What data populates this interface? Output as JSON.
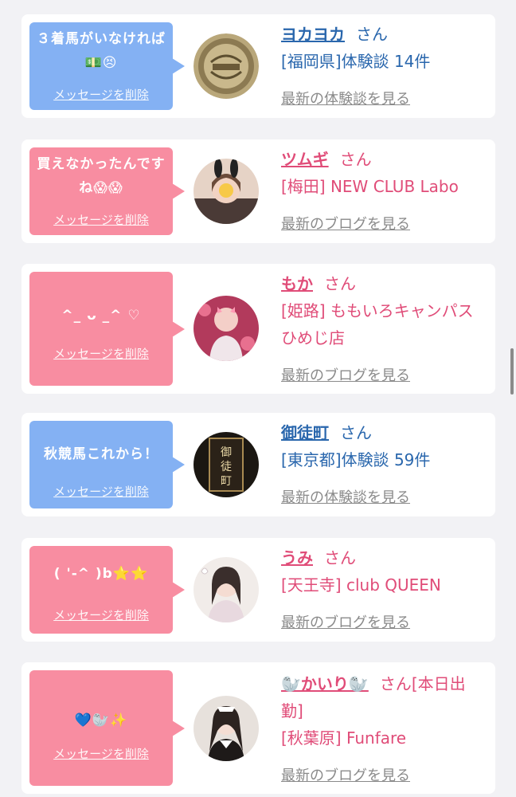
{
  "colors": {
    "blue_bubble": "#84b1f3",
    "pink_bubble": "#f88da1",
    "blue_text": "#2a67ad",
    "pink_text": "#e04c78"
  },
  "delete_label": "メッセージを削除",
  "san_label": "さん",
  "items": [
    {
      "message": "３着馬がいなければ💵😣",
      "name": "ヨカヨカ",
      "shop": "[福岡県]体験談 14件",
      "latest": "最新の体験談を見る"
    },
    {
      "message": "買えなかったんですね😱😱",
      "name": "ツムギ",
      "shop": "[梅田] NEW CLUB Labo",
      "latest": "最新のブログを見る"
    },
    {
      "message": "^_ ᴗ _^ ♡",
      "name": "もか",
      "shop": "[姫路] ももいろキャンパス　ひめじ店",
      "latest": "最新のブログを見る"
    },
    {
      "message": "秋競馬これから！",
      "name": "御徒町",
      "shop": "[東京都]体験談 59件",
      "latest": "最新の体験談を見る"
    },
    {
      "message": "( '-^ )b⭐⭐",
      "name": "うみ",
      "shop": "[天王寺] club QUEEN",
      "latest": "最新のブログを見る"
    },
    {
      "message": "💙🦭✨",
      "name": "🦭かいり🦭",
      "status": "[本日出勤]",
      "shop": "[秋葉原] Funfare",
      "latest": "最新のブログを見る"
    }
  ]
}
